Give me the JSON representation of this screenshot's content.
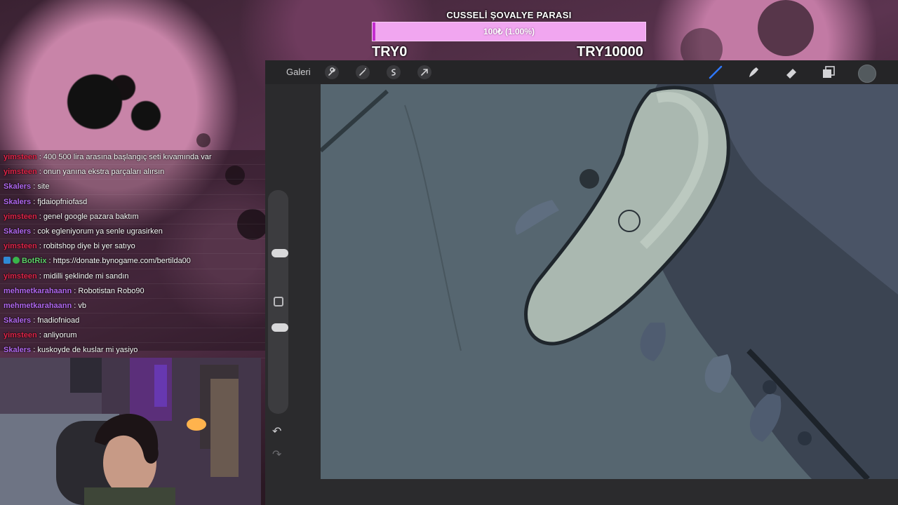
{
  "goal": {
    "title": "CUSSELİ ŞOVALYE PARASI",
    "progress_text": "100₺ (1.00%)",
    "progress_fraction": 0.01,
    "min_label": "TRY0",
    "max_label": "TRY10000",
    "bar_color": "#f1a6f0",
    "fill_color": "#c42ccf"
  },
  "app": {
    "gallery_label": "Galeri",
    "left_tools": [
      "wrench-icon",
      "magic-wand-icon",
      "selection-icon",
      "transform-arrow-icon"
    ],
    "right_tools": [
      "brush-icon",
      "smudge-icon",
      "eraser-icon",
      "layers-icon"
    ],
    "active_tool": "brush-icon",
    "color_swatch": "#535a5e",
    "undo_icon": "undo-icon",
    "redo_icon": "redo-icon"
  },
  "chat": {
    "messages": [
      {
        "user": "yimsteen",
        "color": "#e0254a",
        "text": "400 500 lira arasına başlangıç seti kıvamında var"
      },
      {
        "user": "yimsteen",
        "color": "#e0254a",
        "text": "onun yanına ekstra parçaları alırsın"
      },
      {
        "user": "Skalers",
        "color": "#b268f0",
        "text": "site"
      },
      {
        "user": "Skalers",
        "color": "#b268f0",
        "text": "fjdaiopfniofasd"
      },
      {
        "user": "yimsteen",
        "color": "#e0254a",
        "text": "genel google pazara baktım"
      },
      {
        "user": "Skalers",
        "color": "#b268f0",
        "text": "cok egleniyorum ya senle ugrasirken"
      },
      {
        "user": "yimsteen",
        "color": "#e0254a",
        "text": "robitshop diye bi yer satıyo"
      },
      {
        "user": "BotRix",
        "color": "#5fd16a",
        "text": "https://donate.bynogame.com/bertilda00",
        "badges": true
      },
      {
        "user": "yimsteen",
        "color": "#e0254a",
        "text": "midilli şeklinde mi sandın"
      },
      {
        "user": "mehmetkarahaann",
        "color": "#b268f0",
        "text": "Robotistan Robo90"
      },
      {
        "user": "mehmetkarahaann",
        "color": "#b268f0",
        "text": "vb"
      },
      {
        "user": "Skalers",
        "color": "#b268f0",
        "text": "fnadiofnioad"
      },
      {
        "user": "yimsteen",
        "color": "#e0254a",
        "text": "anliyorum"
      },
      {
        "user": "Skalers",
        "color": "#b268f0",
        "text": "kuskoyde de kuslar mi yasiyo"
      }
    ]
  }
}
